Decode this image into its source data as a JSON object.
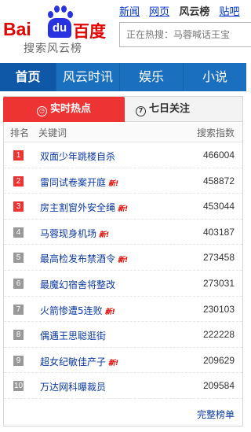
{
  "logo": {
    "bai": "Bai",
    "du": "du",
    "cn": "百度",
    "sub": "搜索风云榜"
  },
  "topnav": {
    "items": [
      "新闻",
      "网页",
      "风云榜",
      "贴吧"
    ],
    "current": "风云榜"
  },
  "search": {
    "placeholder": "正在热搜：马蓉喊话王宝"
  },
  "navbar": {
    "items": [
      "首页",
      "风云时讯",
      "娱乐",
      "小说"
    ],
    "active": "首页"
  },
  "tabs": {
    "active": "实时热点",
    "inactive": "七日关注"
  },
  "table": {
    "headers": [
      "排名",
      "关键词",
      "搜索指数"
    ],
    "rows": [
      {
        "rank": "1",
        "keyword": "双面少年跳楼自杀",
        "new": "",
        "index": "466004"
      },
      {
        "rank": "2",
        "keyword": "雷同试卷案开庭",
        "new": "新!",
        "index": "458872"
      },
      {
        "rank": "3",
        "keyword": "房主割窗外安全绳",
        "new": "新!",
        "index": "453044"
      },
      {
        "rank": "4",
        "keyword": "马蓉现身机场",
        "new": "新!",
        "index": "403187"
      },
      {
        "rank": "5",
        "keyword": "最高检发布禁酒令",
        "new": "新!",
        "index": "273458"
      },
      {
        "rank": "6",
        "keyword": "最魔幻宿舍将整改",
        "new": "",
        "index": "273031"
      },
      {
        "rank": "7",
        "keyword": "火箭惨遭5连败",
        "new": "新!",
        "index": "230103"
      },
      {
        "rank": "8",
        "keyword": "偶遇王思聪逛街",
        "new": "",
        "index": "222228"
      },
      {
        "rank": "9",
        "keyword": "超女纪敏佳产子",
        "new": "新!",
        "index": "209629"
      },
      {
        "rank": "10",
        "keyword": "万达网科曝裁员",
        "new": "",
        "index": "209584"
      }
    ]
  },
  "full_list": "完整榜单",
  "colors": {
    "brand_red": "#e10601",
    "brand_blue": "#2932e1",
    "nav_blue": "#1a6fbf",
    "link": "#0b3aa0"
  }
}
